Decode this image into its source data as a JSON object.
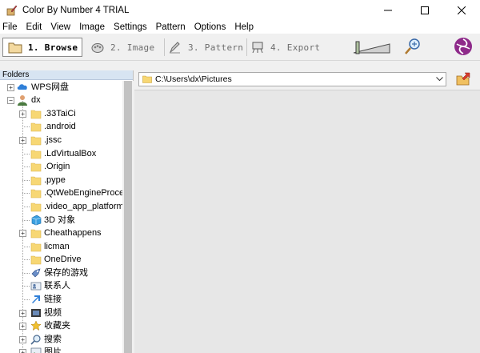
{
  "window": {
    "title": "Color By Number 4 TRIAL",
    "controls": [
      "minimize",
      "maximize",
      "close"
    ]
  },
  "menu": [
    "File",
    "Edit",
    "View",
    "Image",
    "Settings",
    "Pattern",
    "Options",
    "Help"
  ],
  "toolbar": {
    "steps": [
      {
        "label": "1. Browse",
        "icon": "folder-icon",
        "active": true
      },
      {
        "label": "2. Image",
        "icon": "image-icon",
        "active": false
      },
      {
        "label": "3. Pattern",
        "icon": "pencil-icon",
        "active": false
      },
      {
        "label": "4. Export",
        "icon": "easel-icon",
        "active": false
      }
    ],
    "extra_icons": [
      "slider-icon",
      "magnifier-icon",
      "app-logo-icon"
    ]
  },
  "folders": {
    "header": "Folders",
    "items": [
      {
        "label": "WPS网盘",
        "icon": "cloud-icon",
        "level": 0,
        "expander": "+"
      },
      {
        "label": "dx",
        "icon": "user-icon",
        "level": 0,
        "expander": "-"
      },
      {
        "label": ".33TaiCi",
        "icon": "folder-icon",
        "level": 1,
        "expander": "+"
      },
      {
        "label": ".android",
        "icon": "folder-icon",
        "level": 1,
        "expander": ""
      },
      {
        "label": ".jssc",
        "icon": "folder-icon",
        "level": 1,
        "expander": "+"
      },
      {
        "label": ".LdVirtualBox",
        "icon": "folder-icon",
        "level": 1,
        "expander": ""
      },
      {
        "label": ".Origin",
        "icon": "folder-icon",
        "level": 1,
        "expander": ""
      },
      {
        "label": ".pype",
        "icon": "folder-icon",
        "level": 1,
        "expander": ""
      },
      {
        "label": ".QtWebEngineProce:",
        "icon": "folder-icon",
        "level": 1,
        "expander": ""
      },
      {
        "label": ".video_app_platform",
        "icon": "folder-icon",
        "level": 1,
        "expander": ""
      },
      {
        "label": "3D 对象",
        "icon": "cube-icon",
        "level": 1,
        "expander": ""
      },
      {
        "label": "Cheathappens",
        "icon": "folder-icon",
        "level": 1,
        "expander": "+"
      },
      {
        "label": "licman",
        "icon": "folder-icon",
        "level": 1,
        "expander": ""
      },
      {
        "label": "OneDrive",
        "icon": "folder-icon",
        "level": 1,
        "expander": ""
      },
      {
        "label": "保存的游戏",
        "icon": "saved-games-icon",
        "level": 1,
        "expander": ""
      },
      {
        "label": "联系人",
        "icon": "contacts-icon",
        "level": 1,
        "expander": ""
      },
      {
        "label": "链接",
        "icon": "links-icon",
        "level": 1,
        "expander": ""
      },
      {
        "label": "视频",
        "icon": "video-icon",
        "level": 1,
        "expander": "+"
      },
      {
        "label": "收藏夹",
        "icon": "star-icon",
        "level": 1,
        "expander": "+"
      },
      {
        "label": "搜索",
        "icon": "search-icon",
        "level": 1,
        "expander": "+"
      },
      {
        "label": "图片",
        "icon": "pictures-icon",
        "level": 1,
        "expander": "+"
      }
    ]
  },
  "path": {
    "value": "C:\\Users\\dx\\Pictures"
  },
  "colors": {
    "folder": "#f7d774",
    "folders_header": "#d7e4f2",
    "logo": "#8e2a8a"
  }
}
